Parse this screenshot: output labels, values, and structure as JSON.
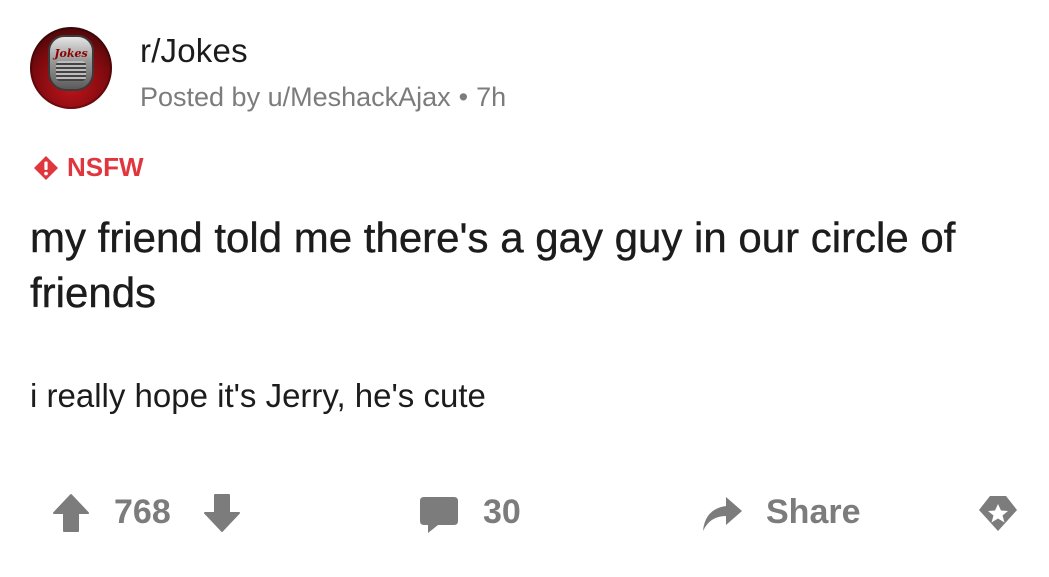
{
  "header": {
    "subreddit": "r/Jokes",
    "avatar_text": "Jokes",
    "posted_by": "Posted by u/MeshackAjax",
    "separator": "•",
    "age": "7h"
  },
  "tag": {
    "label": "NSFW",
    "icon": "alert-diamond-icon",
    "color": "#e0373f"
  },
  "post": {
    "title": "my friend told me there's a gay guy in our circle of friends",
    "body": "i really hope it's Jerry, he's cute"
  },
  "actions": {
    "score": "768",
    "comments": "30",
    "share_label": "Share",
    "icons": [
      "upvote-icon",
      "downvote-icon",
      "comment-icon",
      "share-icon",
      "award-icon"
    ]
  },
  "colors": {
    "text": "#1c1c1c",
    "muted": "#7c7c7c",
    "nsfw": "#e0373f"
  }
}
